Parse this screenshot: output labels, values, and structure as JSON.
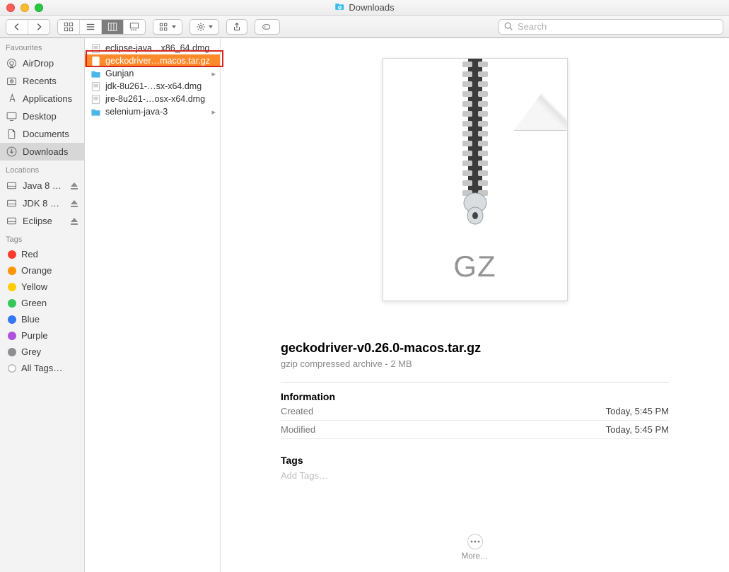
{
  "window": {
    "title": "Downloads"
  },
  "search": {
    "placeholder": "Search"
  },
  "sidebar": {
    "sections": [
      {
        "heading": "Favourites",
        "items": [
          {
            "label": "AirDrop"
          },
          {
            "label": "Recents"
          },
          {
            "label": "Applications"
          },
          {
            "label": "Desktop"
          },
          {
            "label": "Documents"
          },
          {
            "label": "Downloads"
          }
        ]
      },
      {
        "heading": "Locations",
        "items": [
          {
            "label": "Java 8 U…"
          },
          {
            "label": "JDK 8 U…"
          },
          {
            "label": "Eclipse"
          }
        ]
      },
      {
        "heading": "Tags",
        "items": [
          {
            "label": "Red"
          },
          {
            "label": "Orange"
          },
          {
            "label": "Yellow"
          },
          {
            "label": "Green"
          },
          {
            "label": "Blue"
          },
          {
            "label": "Purple"
          },
          {
            "label": "Grey"
          },
          {
            "label": "All Tags…"
          }
        ]
      }
    ]
  },
  "column": {
    "items": [
      {
        "label": "eclipse-java…x86_64.dmg"
      },
      {
        "label": "geckodriver…macos.tar.gz"
      },
      {
        "label": "Gunjan"
      },
      {
        "label": "jdk-8u261-…sx-x64.dmg"
      },
      {
        "label": "jre-8u261-…osx-x64.dmg"
      },
      {
        "label": "selenium-java-3"
      }
    ]
  },
  "preview": {
    "filename": "geckodriver-v0.26.0-macos.tar.gz",
    "subtitle": "gzip compressed archive - 2 MB",
    "thumb_label": "GZ",
    "information_heading": "Information",
    "created_label": "Created",
    "created_value": "Today, 5:45 PM",
    "modified_label": "Modified",
    "modified_value": "Today, 5:45 PM",
    "tags_heading": "Tags",
    "add_tags": "Add Tags…",
    "more": "More…"
  }
}
